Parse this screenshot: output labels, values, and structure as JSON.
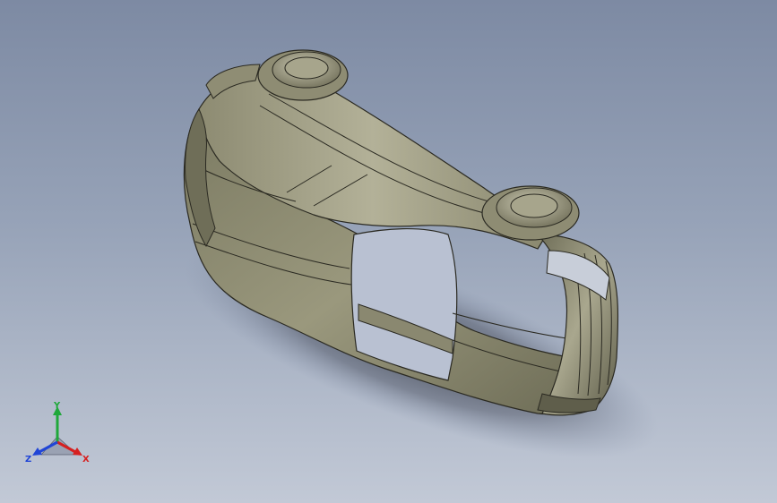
{
  "viewport": {
    "background_top": "#7d8aa3",
    "background_bottom": "#c2c9d6",
    "model_color": "#8c8a70",
    "edge_color": "#2b2a22"
  },
  "triad": {
    "x_label": "X",
    "y_label": "Y",
    "z_label": "Z",
    "x_color": "#d62020",
    "y_color": "#1fa83a",
    "z_color": "#2045d6"
  }
}
